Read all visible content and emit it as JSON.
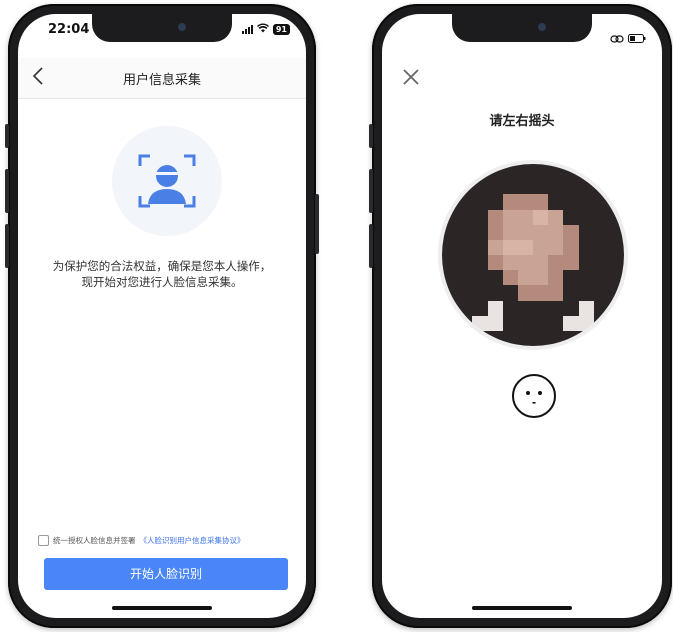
{
  "left_screen": {
    "status_time": "22:04",
    "battery": "91",
    "nav_back_icon": "chevron-left-icon",
    "nav_title": "用户信息采集",
    "description_line1": "为保护您的合法权益，确保是您本人操作，",
    "description_line2": "现开始对您进行人脸信息采集。",
    "agreement_text": "统一授权人脸信息并签署",
    "agreement_link": "《人脸识别用户信息采集协议》",
    "start_button": "开始人脸识别",
    "accent_color": "#4a86f7"
  },
  "right_screen": {
    "close_icon": "close-icon",
    "instruction": "请左右摇头",
    "face_hint_icon": "neutral-face-icon"
  }
}
